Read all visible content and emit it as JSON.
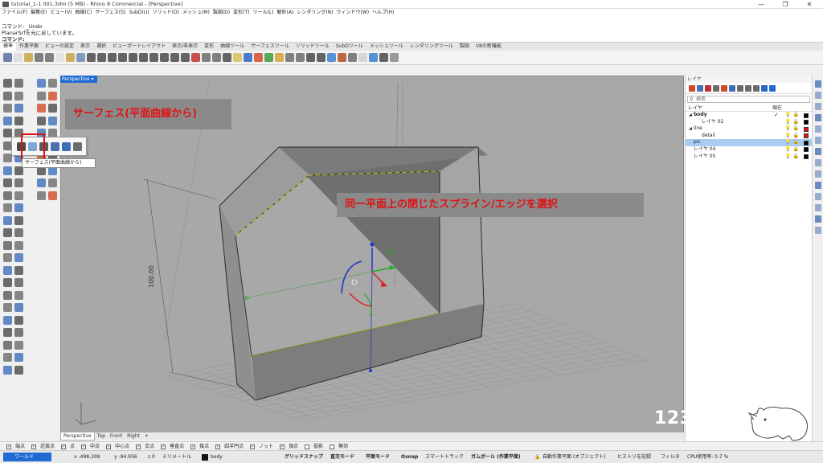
{
  "window": {
    "title": "tutorial_1-1 001.3dm (5 MB) - Rhino 8 Commercial - [Perspective]",
    "controls": [
      "—",
      "❐",
      "✕"
    ]
  },
  "menu": [
    "ファイル(F)",
    "編集(E)",
    "ビュー(V)",
    "曲線(C)",
    "サーフェス(S)",
    "SubD(U)",
    "ソリッド(O)",
    "メッシュ(M)",
    "製図(D)",
    "変形(T)",
    "ツール(L)",
    "解析(A)",
    "レンダリング(N)",
    "ウィンドウ(W)",
    "ヘルプ(H)"
  ],
  "command": {
    "line1": "コマンド: _Undo",
    "line2": "PlanarSrfを元に戻しています。",
    "prompt": "コマンド:"
  },
  "toolbar_tabs": [
    "標準",
    "作業平面",
    "ビューの設定",
    "表示",
    "選択",
    "ビューポートレイアウト",
    "表示/非表示",
    "変形",
    "曲線ツール",
    "サーフェスツール",
    "ソリッドツール",
    "SubDツール",
    "メッシュツール",
    "レンダリングツール",
    "製図",
    "V8の新機能"
  ],
  "viewport": {
    "name": "Perspective",
    "dimension_label": "100.00",
    "tabs": [
      "Perspective",
      "Top",
      "Front",
      "Right"
    ],
    "add_tab": "+"
  },
  "flyout": {
    "tooltip": "サーフェス(平面曲線から)"
  },
  "annotations": {
    "title": "サーフェス(平面曲線から)",
    "instruction": "同一平面上の閉じたスプライン/エッジを選択"
  },
  "layers_panel": {
    "title": "レイヤ",
    "search_placeholder": "検索",
    "col_layer": "レイヤ",
    "col_current": "現在",
    "rows": [
      {
        "name": "body",
        "bold": true,
        "indent": 0,
        "expander": "◢",
        "current": true,
        "color": "#000000",
        "selected": false
      },
      {
        "name": "レイヤ 02",
        "bold": false,
        "indent": 1,
        "expander": "",
        "current": false,
        "color": "#000000",
        "selected": false
      },
      {
        "name": "line",
        "bold": false,
        "indent": 0,
        "expander": "◢",
        "current": false,
        "color": "#e81010",
        "selected": false
      },
      {
        "name": "detail",
        "bold": false,
        "indent": 1,
        "expander": "",
        "current": false,
        "color": "#e81010",
        "selected": false
      },
      {
        "name": "pic",
        "bold": false,
        "indent": 0,
        "expander": "",
        "current": false,
        "color": "#000000",
        "selected": true
      },
      {
        "name": "レイヤ 04",
        "bold": false,
        "indent": 0,
        "expander": "",
        "current": false,
        "color": "#000000",
        "selected": false
      },
      {
        "name": "レイヤ 05",
        "bold": false,
        "indent": 0,
        "expander": "",
        "current": false,
        "color": "#000000",
        "selected": false
      }
    ]
  },
  "osnap": [
    {
      "label": "端点",
      "checked": true
    },
    {
      "label": "近接点",
      "checked": true
    },
    {
      "label": "点",
      "checked": true
    },
    {
      "label": "中点",
      "checked": true
    },
    {
      "label": "中心点",
      "checked": true
    },
    {
      "label": "交点",
      "checked": true
    },
    {
      "label": "垂直点",
      "checked": true
    },
    {
      "label": "接点",
      "checked": true
    },
    {
      "label": "四半円点",
      "checked": true
    },
    {
      "label": "ノット",
      "checked": true
    },
    {
      "label": "頂点",
      "checked": true
    },
    {
      "label": "投影",
      "checked": false
    },
    {
      "label": "無効",
      "checked": false
    }
  ],
  "status": {
    "cplane": "ワールド",
    "x": "x -498.208",
    "y": "y -94.956",
    "z": "z 0",
    "units": "ミリメートル",
    "layer": "body",
    "grid_snap": "グリッドスナップ",
    "ortho": "直交モード",
    "planar": "平面モード",
    "osnap": "Osnap",
    "smarttrack": "スマートトラック",
    "gumball": "ガムボール (作業平面)",
    "auto_cplane": "自動作業平面 (オブジェクト)",
    "history": "ヒストリを記録",
    "filter": "フィルタ",
    "cpu": "CPU使用率: 0.7 %"
  },
  "watermark": "123rhino",
  "colors": {
    "accent_blue": "#1f6ad3",
    "annotation_red": "#e01212",
    "selection": "#a9cdf2",
    "surface_edge": "#d4d000"
  }
}
